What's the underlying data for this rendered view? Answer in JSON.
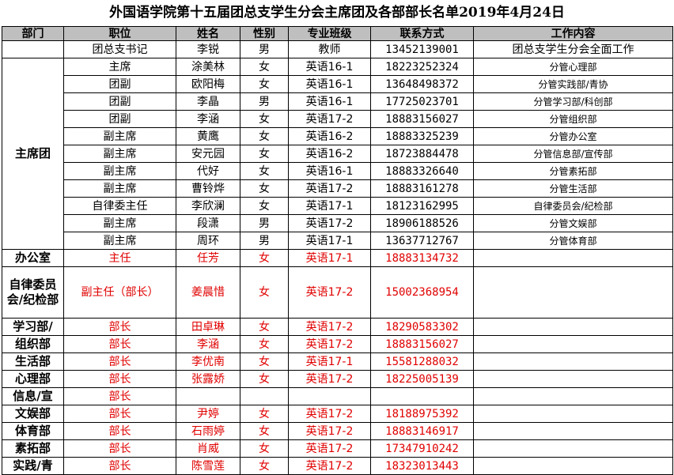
{
  "title": "外国语学院第十五届团总支学生分会主席团及各部部长名单2019年4月24日",
  "headers": [
    "部门",
    "职位",
    "姓名",
    "性别",
    "专业班级",
    "联系方式",
    "工作内容"
  ],
  "secretary": {
    "position": "团总支书记",
    "name": "李锐",
    "gender": "男",
    "class": "教师",
    "phone": "13452139001",
    "duty": "团总支学生分会全面工作"
  },
  "presidium_label": "主席团",
  "presidium": [
    {
      "position": "主席",
      "name": "涂美林",
      "gender": "女",
      "class": "英语16-1",
      "phone": "18223252324",
      "duty": "分管心理部"
    },
    {
      "position": "团副",
      "name": "欧阳梅",
      "gender": "女",
      "class": "英语16-1",
      "phone": "13648498372",
      "duty": "分管实践部/青协"
    },
    {
      "position": "团副",
      "name": "李晶",
      "gender": "男",
      "class": "英语16-1",
      "phone": "17725023701",
      "duty": "分管学习部/科创部"
    },
    {
      "position": "团副",
      "name": "李涵",
      "gender": "女",
      "class": "英语17-2",
      "phone": "18883156027",
      "duty": "分管组织部"
    },
    {
      "position": "副主席",
      "name": "黄鹰",
      "gender": "女",
      "class": "英语16-2",
      "phone": "18883325239",
      "duty": "分管办公室"
    },
    {
      "position": "副主席",
      "name": "安元园",
      "gender": "女",
      "class": "英语16-2",
      "phone": "18723884478",
      "duty": "分管信息部/宣传部"
    },
    {
      "position": "副主席",
      "name": "代好",
      "gender": "女",
      "class": "英语16-1",
      "phone": "18883326640",
      "duty": "分管素拓部"
    },
    {
      "position": "副主席",
      "name": "曹铃烨",
      "gender": "女",
      "class": "英语17-2",
      "phone": "18883161278",
      "duty": "分管生活部"
    },
    {
      "position": "自律委主任",
      "name": "李欣澜",
      "gender": "女",
      "class": "英语17-1",
      "phone": "18123162995",
      "duty": "自律委员会/纪检部"
    },
    {
      "position": "副主席",
      "name": "段潇",
      "gender": "男",
      "class": "英语17-2",
      "phone": "18906188526",
      "duty": "分管文娱部"
    },
    {
      "position": "副主席",
      "name": "周环",
      "gender": "男",
      "class": "英语17-1",
      "phone": "13637712767",
      "duty": "分管体育部"
    }
  ],
  "departments": [
    {
      "dept": "办公室",
      "position": "主任",
      "name": "任芳",
      "gender": "女",
      "class": "英语17-1",
      "phone": "18883134732",
      "duty": ""
    },
    {
      "dept": "自律委员会/纪检部",
      "position": "副主任（部长）",
      "name": "姜晨惜",
      "gender": "女",
      "class": "英语17-2",
      "phone": "15002368954",
      "duty": ""
    },
    {
      "dept": "学习部/",
      "position": "部长",
      "name": "田卓琳",
      "gender": "女",
      "class": "英语17-2",
      "phone": "18290583302",
      "duty": ""
    },
    {
      "dept": "组织部",
      "position": "部长",
      "name": "李涵",
      "gender": "女",
      "class": "英语17-2",
      "phone": "18883156027",
      "duty": ""
    },
    {
      "dept": "生活部",
      "position": "部长",
      "name": "李优南",
      "gender": "女",
      "class": "英语17-1",
      "phone": "15581288032",
      "duty": ""
    },
    {
      "dept": "心理部",
      "position": "部长",
      "name": "张露娇",
      "gender": "女",
      "class": "英语17-2",
      "phone": "18225005139",
      "duty": ""
    },
    {
      "dept": "信息/宣",
      "position": "部长",
      "name": "",
      "gender": "",
      "class": "",
      "phone": "",
      "duty": ""
    },
    {
      "dept": "文娱部",
      "position": "部长",
      "name": "尹婷",
      "gender": "女",
      "class": "英语17-2",
      "phone": "18188975392",
      "duty": ""
    },
    {
      "dept": "体育部",
      "position": "部长",
      "name": "石雨婷",
      "gender": "女",
      "class": "英语17-2",
      "phone": "18883146917",
      "duty": ""
    },
    {
      "dept": "素拓部",
      "position": "部长",
      "name": "肖威",
      "gender": "女",
      "class": "英语17-2",
      "phone": "17347910242",
      "duty": ""
    },
    {
      "dept": "实践/青",
      "position": "部长",
      "name": "陈雪莲",
      "gender": "女",
      "class": "英语17-2",
      "phone": "18323013443",
      "duty": ""
    }
  ]
}
